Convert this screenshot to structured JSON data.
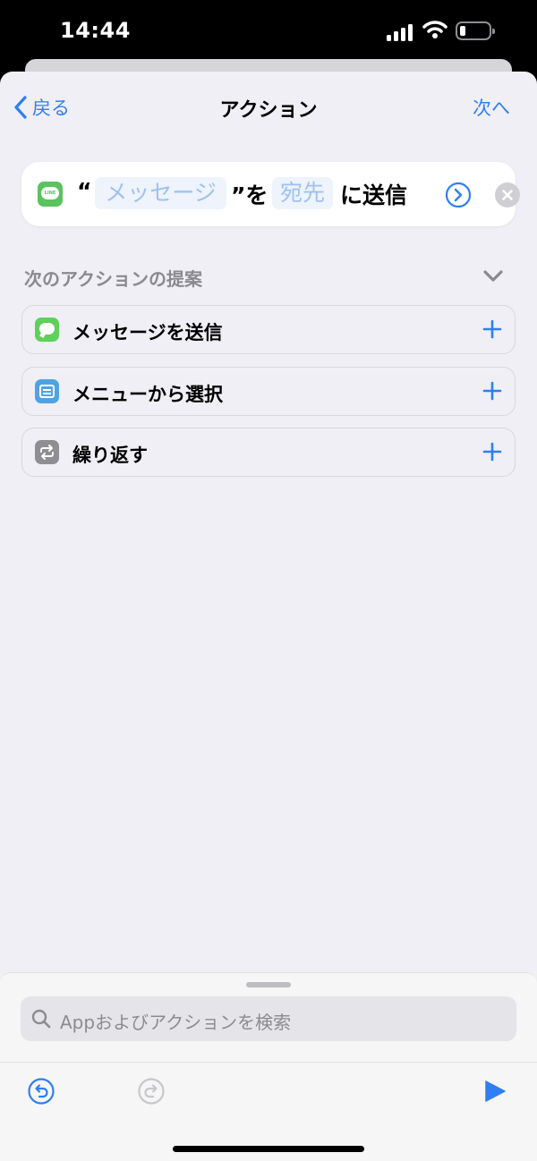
{
  "status_bar": {
    "time": "14:44"
  },
  "nav": {
    "back_label": "戻る",
    "title": "アクション",
    "next_label": "次へ"
  },
  "action": {
    "app_icon": "line-app-icon",
    "app_icon_text": "LINE",
    "open_quote": "“",
    "message_token": "メッセージ",
    "close_quote_particle": "”を",
    "recipient_token": "宛先",
    "suffix": "に送信"
  },
  "suggestions": {
    "header": "次のアクションの提案",
    "items": [
      {
        "label": "メッセージを送信",
        "icon": "messages-icon",
        "color": "#5ed15a"
      },
      {
        "label": "メニューから選択",
        "icon": "menu-icon",
        "color": "#4fa3e3"
      },
      {
        "label": "繰り返す",
        "icon": "repeat-icon",
        "color": "#8e8e93"
      }
    ]
  },
  "search": {
    "placeholder": "Appおよびアクションを検索"
  },
  "colors": {
    "accent": "#2f7ff3",
    "background": "#f0eff5"
  }
}
